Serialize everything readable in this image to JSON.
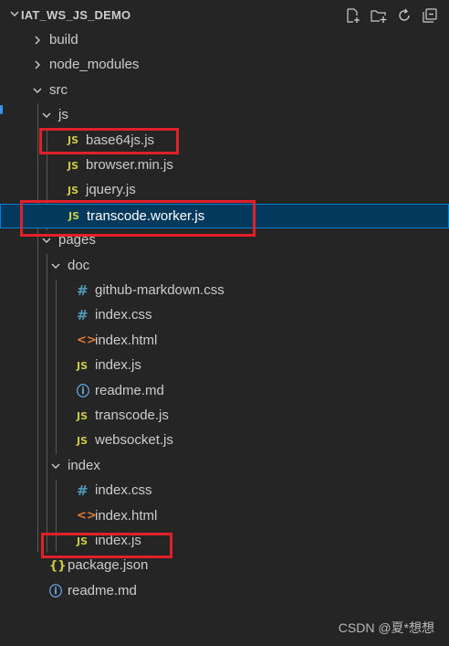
{
  "header": {
    "title": "IAT_WS_JS_DEMO",
    "actions": [
      {
        "name": "new-file-icon"
      },
      {
        "name": "new-folder-icon"
      },
      {
        "name": "refresh-icon"
      },
      {
        "name": "collapse-all-icon"
      }
    ]
  },
  "tree": [
    {
      "label": "build",
      "kind": "folder",
      "expanded": false,
      "depth": 1
    },
    {
      "label": "node_modules",
      "kind": "folder",
      "expanded": false,
      "depth": 1
    },
    {
      "label": "src",
      "kind": "folder",
      "expanded": true,
      "depth": 1
    },
    {
      "label": "js",
      "kind": "folder",
      "expanded": true,
      "depth": 2
    },
    {
      "label": "base64js.js",
      "kind": "js",
      "depth": 3,
      "icon_text": "JS"
    },
    {
      "label": "browser.min.js",
      "kind": "js",
      "depth": 3,
      "icon_text": "JS"
    },
    {
      "label": "jquery.js",
      "kind": "js",
      "depth": 3,
      "icon_text": "JS"
    },
    {
      "label": "transcode.worker.js",
      "kind": "js",
      "depth": 3,
      "icon_text": "JS",
      "selected": true
    },
    {
      "label": "pages",
      "kind": "folder",
      "expanded": true,
      "depth": 2
    },
    {
      "label": "doc",
      "kind": "folder",
      "expanded": true,
      "depth": 3
    },
    {
      "label": "github-markdown.css",
      "kind": "css",
      "depth": 4,
      "icon_text": "#"
    },
    {
      "label": "index.css",
      "kind": "css",
      "depth": 4,
      "icon_text": "#"
    },
    {
      "label": "index.html",
      "kind": "html",
      "depth": 4,
      "icon_text": "<>"
    },
    {
      "label": "index.js",
      "kind": "js",
      "depth": 4,
      "icon_text": "JS"
    },
    {
      "label": "readme.md",
      "kind": "info",
      "depth": 4,
      "icon_text": "ⓘ"
    },
    {
      "label": "transcode.js",
      "kind": "js",
      "depth": 4,
      "icon_text": "JS"
    },
    {
      "label": "websocket.js",
      "kind": "js",
      "depth": 4,
      "icon_text": "JS"
    },
    {
      "label": "index",
      "kind": "folder",
      "expanded": true,
      "depth": 3
    },
    {
      "label": "index.css",
      "kind": "css",
      "depth": 4,
      "icon_text": "#"
    },
    {
      "label": "index.html",
      "kind": "html",
      "depth": 4,
      "icon_text": "<>"
    },
    {
      "label": "index.js",
      "kind": "js",
      "depth": 4,
      "icon_text": "JS"
    },
    {
      "label": "package.json",
      "kind": "json",
      "depth": 1,
      "icon_text": "{}"
    },
    {
      "label": "readme.md",
      "kind": "info",
      "depth": 1,
      "icon_text": "ⓘ"
    }
  ],
  "highlights": [
    "base64js.js",
    "transcode.worker.js",
    "index.js"
  ],
  "watermark": "CSDN @夏*想想",
  "colors": {
    "background": "#252526",
    "selection": "#04395e",
    "selection_border": "#007fd4",
    "highlight_box": "#e0202a",
    "js_icon": "#cbcb41",
    "css_icon": "#519aba",
    "html_icon": "#e37933",
    "info_icon": "#75beff"
  }
}
